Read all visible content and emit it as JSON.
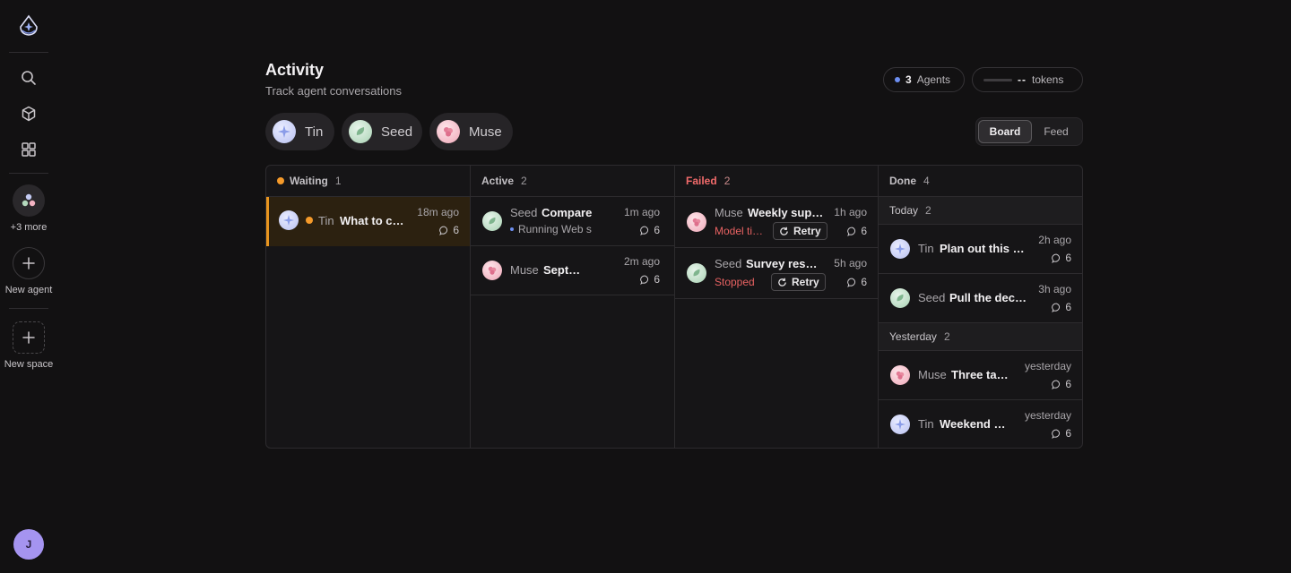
{
  "sidebar": {
    "more_label": "+3 more",
    "new_agent_label": "New agent",
    "new_space_label": "New space",
    "user_initial": "J"
  },
  "header": {
    "title": "Activity",
    "subtitle": "Track agent conversations",
    "agents_count": "3",
    "agents_label": "Agents",
    "tokens_value": "--",
    "tokens_label": "tokens"
  },
  "agents": [
    {
      "name": "Tin"
    },
    {
      "name": "Seed"
    },
    {
      "name": "Muse"
    }
  ],
  "view_toggle": {
    "board": "Board",
    "feed": "Feed",
    "selected": "Board"
  },
  "colors": {
    "accent_blue": "#6d8ff2",
    "waiting_orange": "#f59a2a",
    "failed_red": "#f26b6b",
    "avatar_user": "#a594f0"
  },
  "board": {
    "waiting": {
      "label": "Waiting",
      "count": "1",
      "cards": [
        {
          "agent": "Tin",
          "title": "What to check",
          "time": "18m ago",
          "replies": "6"
        }
      ]
    },
    "active": {
      "label": "Active",
      "count": "2",
      "cards": [
        {
          "agent": "Seed",
          "title": "Compare",
          "status": "Running Web s",
          "time": "1m ago",
          "replies": "6"
        },
        {
          "agent": "Muse",
          "title": "September",
          "time": "2m ago",
          "replies": "6"
        }
      ]
    },
    "failed": {
      "label": "Failed",
      "count": "2",
      "cards": [
        {
          "agent": "Muse",
          "title": "Weekly support",
          "error": "Model timeout",
          "retry": "Retry",
          "time": "1h ago",
          "replies": "6"
        },
        {
          "agent": "Seed",
          "title": "Survey responses",
          "error": "Stopped",
          "retry": "Retry",
          "time": "5h ago",
          "replies": "6"
        }
      ]
    },
    "done": {
      "label": "Done",
      "count": "4",
      "today": {
        "label": "Today",
        "count": "2"
      },
      "yesterday": {
        "label": "Yesterday",
        "count": "2"
      },
      "cards": [
        {
          "agent": "Tin",
          "title": "Plan out this week",
          "time": "2h ago",
          "replies": "6"
        },
        {
          "agent": "Seed",
          "title": "Pull the decision",
          "time": "3h ago",
          "replies": "6"
        },
        {
          "agent": "Muse",
          "title": "Three takeaways",
          "time": "yesterday",
          "replies": "6"
        },
        {
          "agent": "Tin",
          "title": "Weekend grocery",
          "time": "yesterday",
          "replies": "6"
        }
      ]
    }
  }
}
